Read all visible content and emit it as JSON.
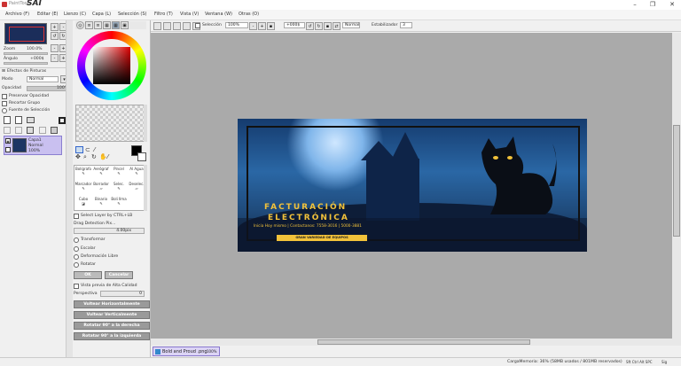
{
  "app": {
    "logo_small": "PaintTool",
    "logo_big": "SAI"
  },
  "menu": [
    "Archivo (F)",
    "Editar (E)",
    "Lienzo (C)",
    "Capa (L)",
    "Selección (S)",
    "Filtro (T)",
    "Vista (V)",
    "Ventana (W)",
    "Otras (O)"
  ],
  "navigator": {
    "zoom_label": "Zoom",
    "zoom_value": "100.0%",
    "angle_label": "Ángulo",
    "angle_value": "+000$"
  },
  "brush": {
    "effects_label": "Efectos de Pinturas",
    "mode_label": "Modo",
    "mode_value": "Normal",
    "opacity_label": "Opacidad",
    "opacity_value": "100%",
    "preserve_opacity": "Preservar Opacidad",
    "clip_group": "Recortar Grupo",
    "selection_source": "Fuente de Selección"
  },
  "layer": {
    "name": "Capa1",
    "mode": "Normal",
    "opacity": "100%"
  },
  "tools": {
    "row1": [
      "Bolígrafo",
      "Aerógraf",
      "Pincel",
      "Al Agua"
    ],
    "row2": [
      "Marcador",
      "Borrador",
      "Selec.",
      "Deselec."
    ],
    "row3": [
      "Cubo",
      "Binario",
      "Boli Ilma",
      ""
    ]
  },
  "options": {
    "select_layer": "Select Layer by CTRL+LB",
    "drag_label": "Drag Detection Pix...",
    "drag_value": "4.00pix",
    "radios": [
      "Transformar",
      "Escalar",
      "Deformación Libre",
      "Rotatar"
    ],
    "ok": "OK",
    "cancel": "Cancelar",
    "preview_hq": "Vista previa de Alta Calidad",
    "perspective_label": "Perspectiva",
    "perspective_value": "0",
    "buttons": [
      "Voltear Horizontalmente",
      "Voltear Verticalmente",
      "Rotatar 90° a la derecha",
      "Rotatar 90° a la izquierda"
    ]
  },
  "toolbar": {
    "selection_label": "Selección",
    "zoom": "100%",
    "angle": "+000$",
    "mode": "Normal",
    "stabilizer_label": "Estabilizador",
    "stabilizer_value": "3"
  },
  "artwork": {
    "title1": "FACTURACIÓN",
    "title2": "ELECTRÓNICA",
    "line": "Inicia Hoy mismo | Contactanos: 7558-3016 | 5000-3881",
    "banner": "GRAN VARIEDAD DE EQUIPOS"
  },
  "document": {
    "tab_name": "Bold and Proud .png",
    "tab_zoom": "100%"
  },
  "status": {
    "memory": "CargaMemoria: 36% (58MB usados / 801MB reservados)",
    "keys": "Sft Ctrl Alt SPC",
    "indicator": "Sig"
  }
}
